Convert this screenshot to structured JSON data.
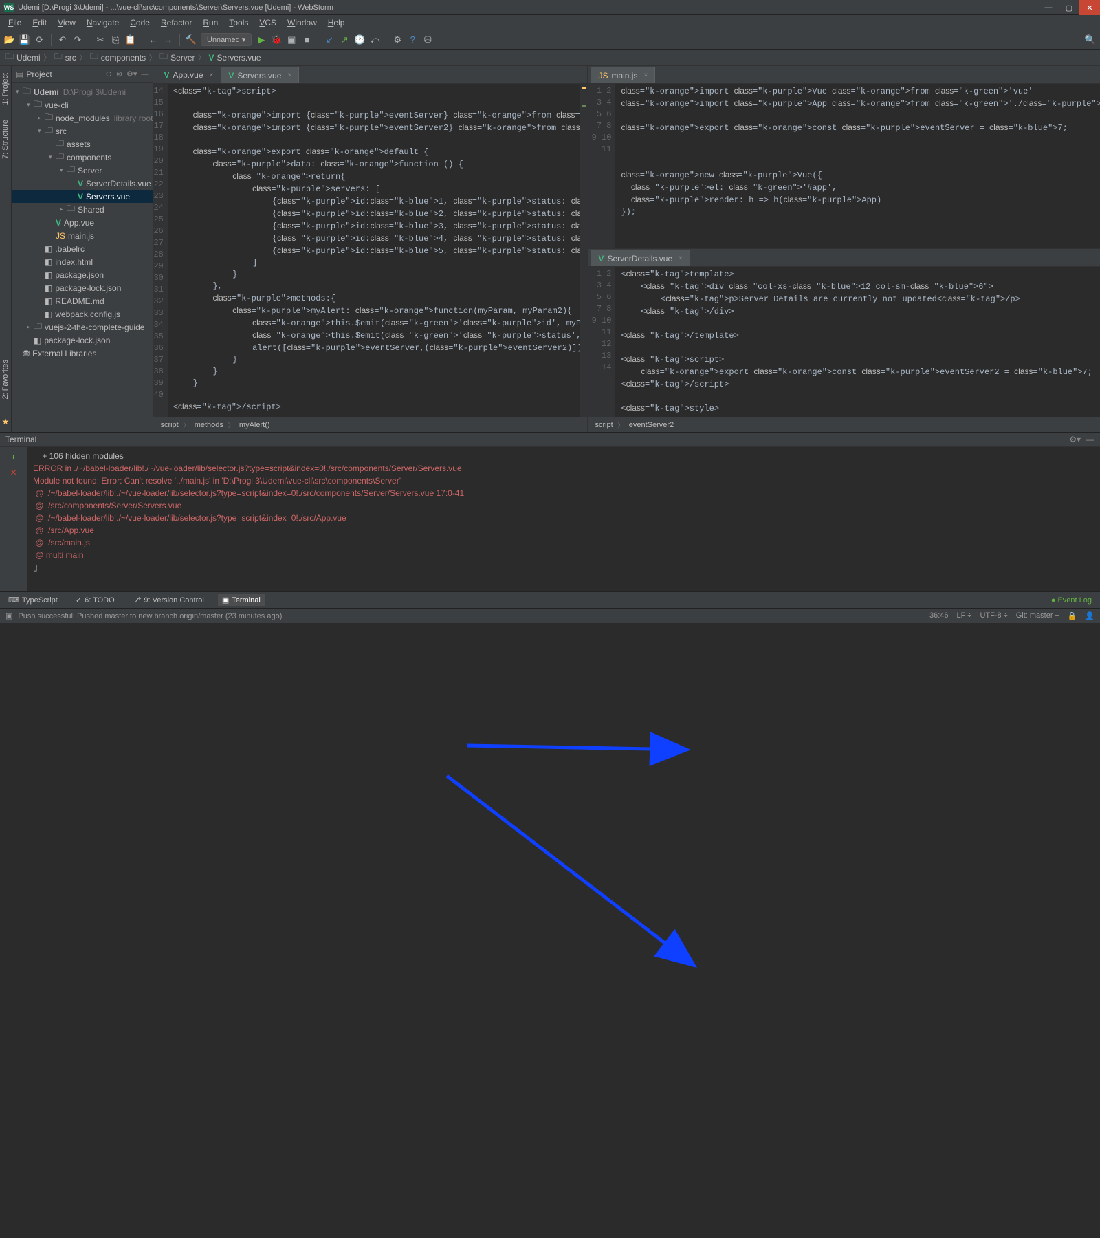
{
  "window": {
    "title": "Udemi [D:\\Progi 3\\Udemi] - ...\\vue-cli\\src\\components\\Server\\Servers.vue [Udemi] - WebStorm"
  },
  "menu": [
    "File",
    "Edit",
    "View",
    "Navigate",
    "Code",
    "Refactor",
    "Run",
    "Tools",
    "VCS",
    "Window",
    "Help"
  ],
  "runConfig": "Unnamed",
  "breadcrumbs": [
    "Udemi",
    "src",
    "components",
    "Server",
    "Servers.vue"
  ],
  "projectHeader": "Project",
  "tree": {
    "root": "Udemi",
    "rootPath": "D:\\Progi 3\\Udemi",
    "nodes": [
      {
        "d": 1,
        "a": "▾",
        "i": "folder",
        "t": "vue-cli"
      },
      {
        "d": 2,
        "a": "▸",
        "i": "folder",
        "t": "node_modules",
        "dim": "library root"
      },
      {
        "d": 2,
        "a": "▾",
        "i": "folder",
        "t": "src"
      },
      {
        "d": 3,
        "a": "",
        "i": "folder",
        "t": "assets"
      },
      {
        "d": 3,
        "a": "▾",
        "i": "folder",
        "t": "components"
      },
      {
        "d": 4,
        "a": "▾",
        "i": "folder",
        "t": "Server"
      },
      {
        "d": 5,
        "a": "",
        "i": "vue",
        "t": "ServerDetails.vue"
      },
      {
        "d": 5,
        "a": "",
        "i": "vue",
        "t": "Servers.vue",
        "sel": true
      },
      {
        "d": 4,
        "a": "▸",
        "i": "folder",
        "t": "Shared"
      },
      {
        "d": 3,
        "a": "",
        "i": "vue",
        "t": "App.vue"
      },
      {
        "d": 3,
        "a": "",
        "i": "js",
        "t": "main.js"
      },
      {
        "d": 2,
        "a": "",
        "i": "file",
        "t": ".babelrc"
      },
      {
        "d": 2,
        "a": "",
        "i": "file",
        "t": "index.html"
      },
      {
        "d": 2,
        "a": "",
        "i": "file",
        "t": "package.json"
      },
      {
        "d": 2,
        "a": "",
        "i": "file",
        "t": "package-lock.json"
      },
      {
        "d": 2,
        "a": "",
        "i": "file",
        "t": "README.md"
      },
      {
        "d": 2,
        "a": "",
        "i": "file",
        "t": "webpack.config.js"
      },
      {
        "d": 1,
        "a": "▸",
        "i": "folder",
        "t": "vuejs-2-the-complete-guide"
      },
      {
        "d": 1,
        "a": "",
        "i": "file",
        "t": "package-lock.json"
      },
      {
        "d": 0,
        "a": "",
        "i": "lib",
        "t": "External Libraries"
      }
    ]
  },
  "editorLeft": {
    "tabs": [
      {
        "name": "App.vue"
      },
      {
        "name": "Servers.vue",
        "active": true
      }
    ],
    "startLine": 14,
    "code": "<script>\n\n    import {eventServer} from '../main.js';\n    import {eventServer2} from './ServerDetails.vue';\n\n    export default {\n        data: function () {\n            return{\n                servers: [\n                    {id:1, status: 'Normal'},\n                    {id:2, status: 'Critical'},\n                    {id:3, status: 'Unknown'},\n                    {id:4, status: 'Not Identified'},\n                    {id:5, status: 'None'},\n                ]\n            }\n        },\n        methods:{\n            myAlert: function(myParam, myParam2){\n                this.$emit('id', myParam);\n                this.$emit('status', myParam2);\n                alert([eventServer,(eventServer2)])\n            }\n        }\n    }\n\n</script>",
    "bc": [
      "script",
      "methods",
      "myAlert()"
    ]
  },
  "editorTopRight": {
    "tabs": [
      {
        "name": "main.js",
        "active": true
      }
    ],
    "startLine": 1,
    "code": "import Vue from 'vue'\nimport App from './App.vue'\n\nexport const eventServer = 7;\n\n\n\nnew Vue({\n  el: '#app',\n  render: h => h(App)\n});"
  },
  "editorBotRight": {
    "tabs": [
      {
        "name": "ServerDetails.vue",
        "active": true
      }
    ],
    "startLine": 1,
    "code": "<template>\n    <div class=\"col-xs-12 col-sm-6\">\n        <p>Server Details are currently not updated</p>\n    </div>\n\n</template>\n\n<script>\n    export const eventServer2 = 7;\n</script>\n\n<style>\n\n</style>",
    "bc": [
      "script",
      "eventServer2"
    ]
  },
  "terminal": {
    "title": "Terminal",
    "lines": [
      {
        "c": "",
        "t": "    + 106 hidden modules"
      },
      {
        "c": "",
        "t": ""
      },
      {
        "c": "err",
        "t": "ERROR in ./~/babel-loader/lib!./~/vue-loader/lib/selector.js?type=script&index=0!./src/components/Server/Servers.vue"
      },
      {
        "c": "err",
        "t": "Module not found: Error: Can't resolve '../main.js' in 'D:\\Progi 3\\Udemi\\vue-cli\\src\\components\\Server'"
      },
      {
        "c": "err",
        "t": " @ ./~/babel-loader/lib!./~/vue-loader/lib/selector.js?type=script&index=0!./src/components/Server/Servers.vue 17:0-41"
      },
      {
        "c": "err",
        "t": " @ ./src/components/Server/Servers.vue"
      },
      {
        "c": "err",
        "t": " @ ./~/babel-loader/lib!./~/vue-loader/lib/selector.js?type=script&index=0!./src/App.vue"
      },
      {
        "c": "err",
        "t": " @ ./src/App.vue"
      },
      {
        "c": "err",
        "t": " @ ./src/main.js"
      },
      {
        "c": "err",
        "t": " @ multi main"
      },
      {
        "c": "",
        "t": "▯"
      }
    ]
  },
  "bottomTabs": [
    {
      "i": "⌨",
      "t": "TypeScript"
    },
    {
      "i": "✓",
      "t": "6: TODO"
    },
    {
      "i": "⎇",
      "t": "9: Version Control"
    },
    {
      "i": "▣",
      "t": "Terminal",
      "active": true
    }
  ],
  "eventLog": "Event Log",
  "status": {
    "msg": "Push successful: Pushed master to new branch origin/master (23 minutes ago)",
    "pos": "36:46",
    "lf": "LF",
    "enc": "UTF-8",
    "git": "Git: master"
  },
  "sideTabs": {
    "l1": "1: Project",
    "l2": "7: Structure",
    "lb": "2: Favorites"
  }
}
